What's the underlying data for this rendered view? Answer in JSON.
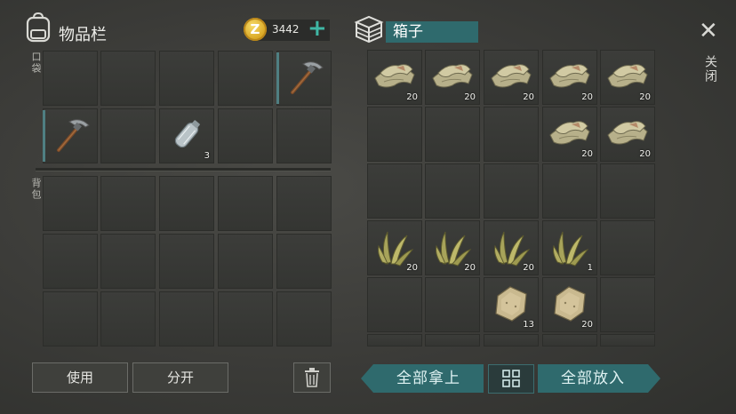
{
  "inventory": {
    "title": "物品栏",
    "pocket_label": "口袋",
    "backpack_label": "背包",
    "coins": "3442",
    "add_symbol": "+",
    "pocket_rows": [
      [
        {
          "item": "",
          "qty": ""
        },
        {
          "item": "",
          "qty": ""
        },
        {
          "item": "",
          "qty": ""
        },
        {
          "item": "",
          "qty": ""
        },
        {
          "item": "pickaxe",
          "qty": "",
          "equipped": true
        }
      ],
      [
        {
          "item": "pickaxe",
          "qty": "",
          "equipped": true
        },
        {
          "item": "",
          "qty": ""
        },
        {
          "item": "plastic-bottle",
          "qty": "3"
        },
        {
          "item": "",
          "qty": ""
        },
        {
          "item": "",
          "qty": ""
        }
      ]
    ],
    "backpack_rows": 3,
    "buttons": {
      "use": "使用",
      "split": "分开"
    }
  },
  "chest": {
    "title": "箱子",
    "rows": [
      [
        {
          "item": "cloth",
          "qty": "20"
        },
        {
          "item": "cloth",
          "qty": "20"
        },
        {
          "item": "cloth",
          "qty": "20"
        },
        {
          "item": "cloth",
          "qty": "20"
        },
        {
          "item": "cloth",
          "qty": "20"
        }
      ],
      [
        {
          "item": "",
          "qty": ""
        },
        {
          "item": "",
          "qty": ""
        },
        {
          "item": "",
          "qty": ""
        },
        {
          "item": "cloth",
          "qty": "20"
        },
        {
          "item": "cloth",
          "qty": "20"
        }
      ],
      [
        {
          "item": "",
          "qty": ""
        },
        {
          "item": "",
          "qty": ""
        },
        {
          "item": "",
          "qty": ""
        },
        {
          "item": "",
          "qty": ""
        },
        {
          "item": "",
          "qty": ""
        }
      ],
      [
        {
          "item": "plant-fiber",
          "qty": "20"
        },
        {
          "item": "plant-fiber",
          "qty": "20"
        },
        {
          "item": "plant-fiber",
          "qty": "20"
        },
        {
          "item": "plant-fiber",
          "qty": "1"
        },
        {
          "item": "",
          "qty": ""
        }
      ],
      [
        {
          "item": "",
          "qty": ""
        },
        {
          "item": "",
          "qty": ""
        },
        {
          "item": "leather",
          "qty": "13"
        },
        {
          "item": "leather",
          "qty": "20"
        },
        {
          "item": "",
          "qty": ""
        }
      ]
    ],
    "buttons": {
      "take_all": "全部拿上",
      "put_all": "全部放入"
    }
  },
  "close": {
    "symbol": "✕",
    "label": "关闭"
  },
  "colors": {
    "accent": "#2f6a6d",
    "background": "#3b3b38",
    "slot": "#373835"
  }
}
